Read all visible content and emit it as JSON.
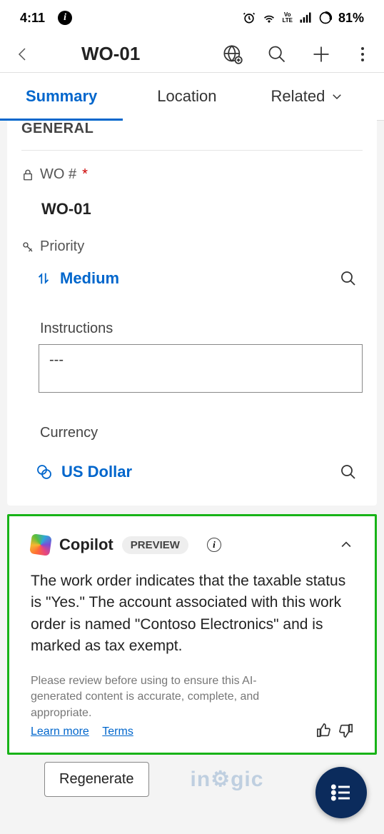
{
  "status_bar": {
    "time": "4:11",
    "battery": "81%",
    "volte": "Vo\nLTE"
  },
  "header": {
    "title": "WO-01"
  },
  "tabs": [
    {
      "label": "Summary",
      "active": true
    },
    {
      "label": "Location",
      "active": false
    },
    {
      "label": "Related",
      "active": false
    }
  ],
  "general": {
    "section_title": "GENERAL",
    "wo_label": "WO #",
    "wo_value": "WO-01",
    "priority_label": "Priority",
    "priority_value": "Medium",
    "instructions_label": "Instructions",
    "instructions_value": "---",
    "currency_label": "Currency",
    "currency_value": "US Dollar"
  },
  "copilot": {
    "title": "Copilot",
    "badge": "PREVIEW",
    "body": "The work order indicates that the taxable status is \"Yes.\" The account associated with this work order is named \"Contoso Electronics\" and is marked as tax exempt.",
    "disclaimer": "Please review before using to ensure this AI-generated content is accurate, complete, and appropriate.",
    "learn_more": "Learn more",
    "terms": "Terms",
    "regenerate": "Regenerate"
  },
  "watermark": "in gic"
}
